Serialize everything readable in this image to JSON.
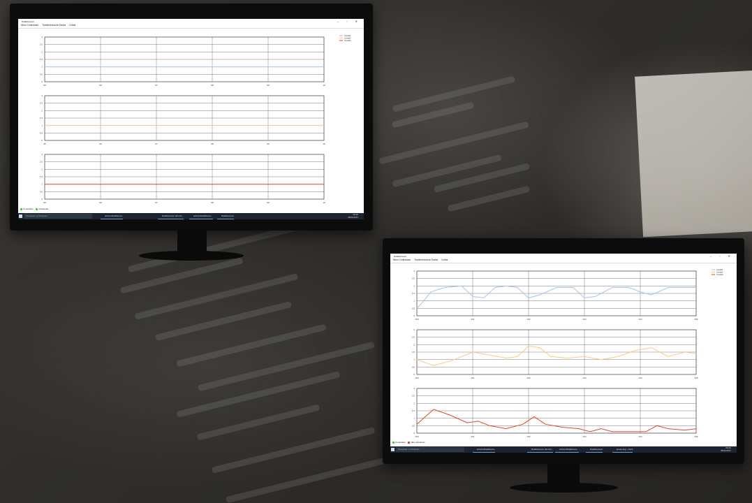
{
  "app_title": "DataReceiver",
  "menu": [
    "Micro Controlador",
    "Transferencia de Dados",
    "Coleta"
  ],
  "legend": [
    "Canal1",
    "Canal2",
    "Canal3"
  ],
  "colors": {
    "canal1": "#a9c4f2",
    "canal2": "#f8cc8a",
    "canal3": "#e2452a"
  },
  "window_buttons": "–  ▫  ✕",
  "status_left": {
    "a": "Conectado",
    "b": "Coletando",
    "b_alt": "Não Coletando"
  },
  "taskbar": {
    "search": "Pesquisar no Windows",
    "apps": [
      "arduinoDataReceiv",
      "DataReceiver (Em Ex...",
      "arduinoDataReceiv...",
      "DataReceiver"
    ],
    "extra_app": "janela.png - Paint",
    "time": "09:20",
    "date": "08/11/2017",
    "lang": "POR PTB"
  },
  "chart_data": [
    {
      "type": "line",
      "title": "",
      "xlabel": "",
      "ylabel": "",
      "x_ticks": [
        "05",
        "06",
        "07",
        "08",
        "09",
        "10"
      ],
      "y_ticks": [
        "0",
        "0.5",
        "1",
        "1.5",
        "2",
        "2.5",
        "3"
      ],
      "ylim": [
        0,
        3
      ],
      "series": [
        {
          "name": "Canal1",
          "color": "#a9c4f2",
          "points": [
            [
              0,
              1
            ],
            [
              5,
              1
            ]
          ]
        }
      ]
    },
    {
      "type": "line",
      "x_ticks": [
        "05",
        "06",
        "07",
        "08",
        "09",
        "10"
      ],
      "y_ticks": [
        "0",
        "0.5",
        "1",
        "1.5",
        "2",
        "2.5",
        "3"
      ],
      "ylim": [
        0,
        3
      ],
      "series": [
        {
          "name": "Canal2",
          "color": "#f8cc8a",
          "points": [
            [
              0,
              1
            ],
            [
              5,
              1
            ]
          ]
        }
      ]
    },
    {
      "type": "line",
      "x_ticks": [
        "05",
        "06",
        "07",
        "08",
        "09",
        "10"
      ],
      "y_ticks": [
        "0",
        "0.5",
        "1",
        "1.5",
        "2",
        "2.5",
        "3"
      ],
      "ylim": [
        0,
        3
      ],
      "series": [
        {
          "name": "Canal3",
          "color": "#e2452a",
          "points": [
            [
              0,
              1
            ],
            [
              5,
              1
            ]
          ]
        }
      ]
    },
    {
      "type": "line",
      "x_ticks": [
        "100",
        "101",
        "102",
        "103",
        "104",
        "105"
      ],
      "y_ticks": [
        "0",
        "0.5",
        "1",
        "1.5",
        "2",
        "2.5",
        "3"
      ],
      "ylim": [
        0,
        3
      ],
      "series": [
        {
          "name": "Canal1",
          "color": "#a9c4f2",
          "points": [
            [
              0,
              0.5
            ],
            [
              0.1,
              0.9
            ],
            [
              0.25,
              1.6
            ],
            [
              0.5,
              1.9
            ],
            [
              0.8,
              2.0
            ],
            [
              1.0,
              1.3
            ],
            [
              1.2,
              1.2
            ],
            [
              1.4,
              1.9
            ],
            [
              1.6,
              2.0
            ],
            [
              1.8,
              1.9
            ],
            [
              2.0,
              1.2
            ],
            [
              2.2,
              1.4
            ],
            [
              2.5,
              1.9
            ],
            [
              2.8,
              1.9
            ],
            [
              3.0,
              1.2
            ],
            [
              3.2,
              1.3
            ],
            [
              3.5,
              1.9
            ],
            [
              3.8,
              1.9
            ],
            [
              4.0,
              1.6
            ],
            [
              4.2,
              1.4
            ],
            [
              4.5,
              1.9
            ],
            [
              4.8,
              1.9
            ],
            [
              5.0,
              1.9
            ]
          ]
        }
      ]
    },
    {
      "type": "line",
      "x_ticks": [
        "100",
        "101",
        "102",
        "103",
        "104",
        "105"
      ],
      "y_ticks": [
        "0",
        "0.5",
        "1",
        "1.5",
        "2",
        "2.5",
        "3"
      ],
      "ylim": [
        0,
        3
      ],
      "series": [
        {
          "name": "Canal2",
          "color": "#f8cc8a",
          "points": [
            [
              0,
              1.0
            ],
            [
              0.3,
              0.6
            ],
            [
              0.6,
              0.9
            ],
            [
              1.0,
              1.5
            ],
            [
              1.3,
              1.3
            ],
            [
              1.6,
              1.1
            ],
            [
              1.8,
              1.2
            ],
            [
              2.0,
              1.9
            ],
            [
              2.2,
              1.8
            ],
            [
              2.4,
              1.2
            ],
            [
              2.7,
              1.1
            ],
            [
              3.0,
              1.2
            ],
            [
              3.3,
              1.0
            ],
            [
              3.6,
              1.2
            ],
            [
              3.9,
              1.6
            ],
            [
              4.2,
              1.8
            ],
            [
              4.5,
              1.2
            ],
            [
              4.8,
              1.5
            ],
            [
              5.0,
              1.4
            ]
          ]
        }
      ]
    },
    {
      "type": "line",
      "x_ticks": [
        "100",
        "101",
        "102",
        "103",
        "104",
        "105"
      ],
      "y_ticks": [
        "0",
        "0.5",
        "1",
        "1.5",
        "2",
        "2.5",
        "3"
      ],
      "ylim": [
        0,
        3
      ],
      "series": [
        {
          "name": "Canal3",
          "color": "#e2452a",
          "points": [
            [
              0,
              0.6
            ],
            [
              0.3,
              1.6
            ],
            [
              0.6,
              1.2
            ],
            [
              0.9,
              0.7
            ],
            [
              1.1,
              0.8
            ],
            [
              1.3,
              0.5
            ],
            [
              1.6,
              0.3
            ],
            [
              1.9,
              0.6
            ],
            [
              2.1,
              1.1
            ],
            [
              2.3,
              0.6
            ],
            [
              2.6,
              0.4
            ],
            [
              2.9,
              0.3
            ],
            [
              3.1,
              0.1
            ],
            [
              3.3,
              0.3
            ],
            [
              3.5,
              0.1
            ],
            [
              3.8,
              0.1
            ],
            [
              4.1,
              0.1
            ],
            [
              4.3,
              0.5
            ],
            [
              4.5,
              0.3
            ],
            [
              4.8,
              0.2
            ],
            [
              5.0,
              0.3
            ]
          ]
        }
      ]
    }
  ]
}
